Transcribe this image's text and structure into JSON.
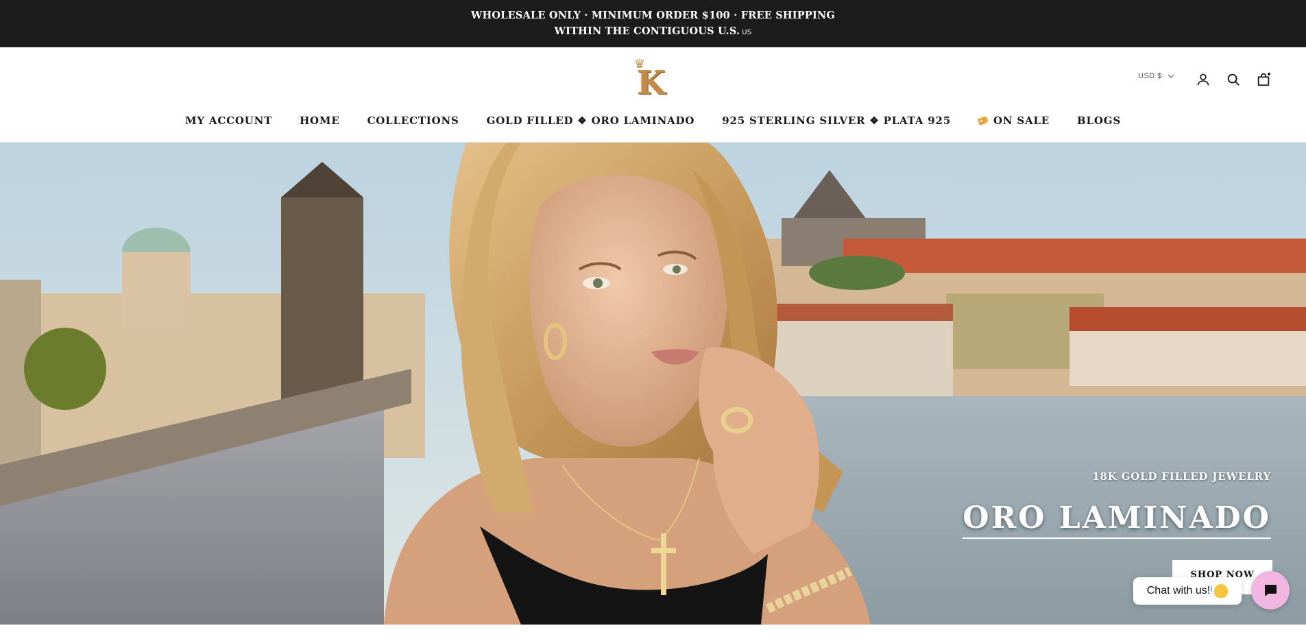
{
  "announcement": {
    "text": "WHOLESALE ONLY · MINIMUM ORDER $100 · FREE SHIPPING WITHIN THE CONTIGUOUS U.S.",
    "suffix": "US"
  },
  "header": {
    "logo_letter": "K",
    "currency": "USD $",
    "icons": [
      "account-icon",
      "search-icon",
      "cart-icon"
    ]
  },
  "nav": {
    "items": [
      {
        "label": "MY ACCOUNT"
      },
      {
        "label": "HOME"
      },
      {
        "label": "COLLECTIONS"
      },
      {
        "label": "GOLD FILLED ❖ ORO LAMINADO"
      },
      {
        "label": "925 STERLING SILVER ❖ PLATA 925"
      },
      {
        "label": "ON SALE",
        "icon": "tag-icon"
      },
      {
        "label": "BLOGS"
      }
    ]
  },
  "hero": {
    "subtitle": "18K GOLD FILLED JEWELRY",
    "title": "ORO LAMINADO",
    "cta": "SHOP NOW"
  },
  "chat": {
    "bubble_text": "Chat with us!",
    "bubble_icon": "waving-hand-icon",
    "launcher_icon": "chat-icon"
  },
  "colors": {
    "announcement_bg": "#1c1c1c",
    "chat_launcher": "#f2b6e2",
    "logo_gold": "#c58b4a"
  }
}
